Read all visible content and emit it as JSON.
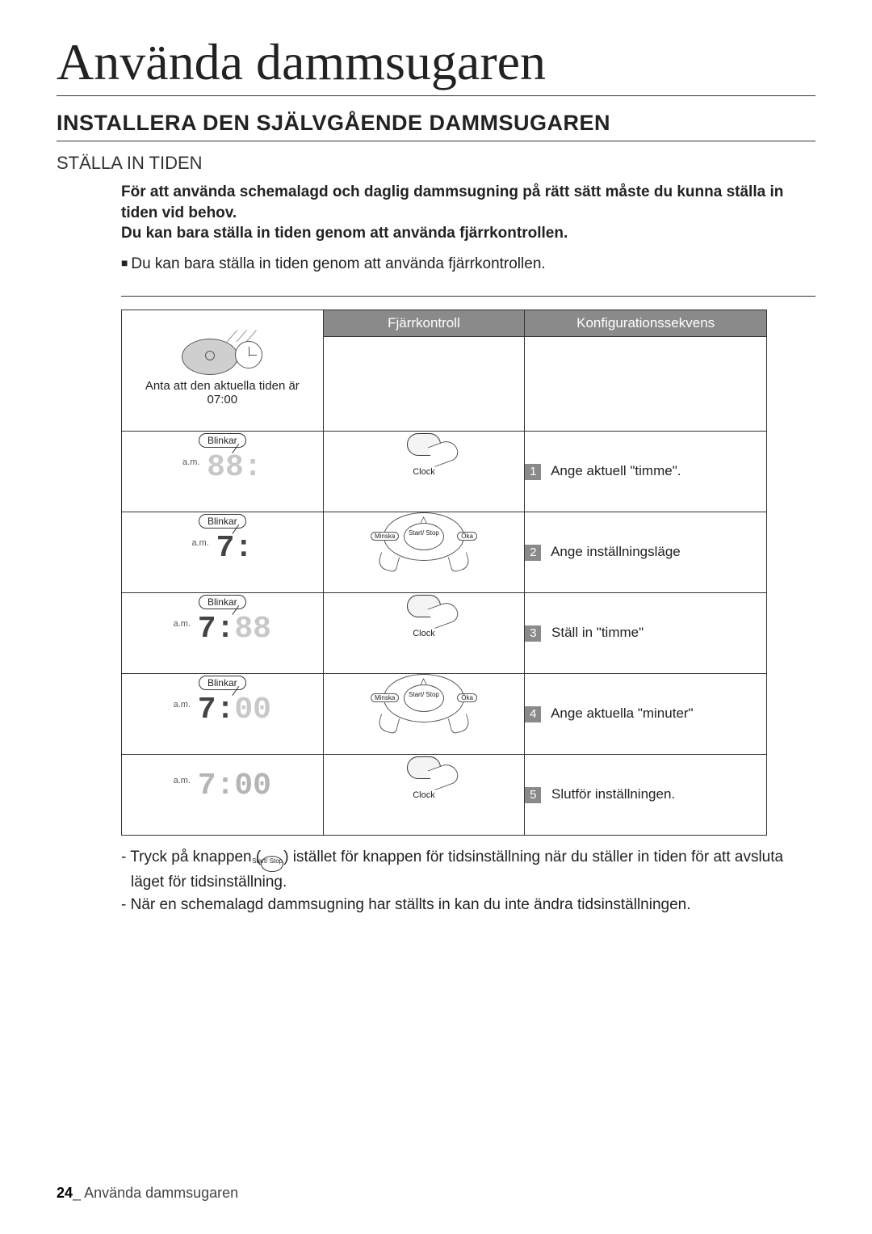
{
  "doc_title": "Använda dammsugaren",
  "section_title": "INSTALLERA DEN SJÄLVGÅENDE DAMMSUGAREN",
  "subsection_title": "STÄLLA IN TIDEN",
  "intro_line1": "För att använda schemalagd och daglig dammsugning på rätt sätt måste du kunna ställa in tiden vid behov.",
  "intro_line2": "Du kan bara ställa in tiden genom att använda fjärrkontrollen.",
  "bullet": "Du kan bara ställa in tiden genom att använda fjärrkontrollen.",
  "headers": {
    "remote": "Fjärrkontroll",
    "config": "Konfigurationssekvens"
  },
  "intro_cell": {
    "line1": "Anta att den aktuella tiden är",
    "line2": "07:00"
  },
  "labels": {
    "blinkar": "Blinkar",
    "am": "a.m.",
    "clock_btn": "Clock",
    "minska": "Minska",
    "oka": "Öka",
    "start_stop": "Start/\nStop"
  },
  "steps": [
    {
      "num": "1",
      "text": "Ange aktuell \"timme\".",
      "remote": "clock",
      "digits": "88:",
      "digit_style": "dim"
    },
    {
      "num": "2",
      "text": "Ange inställningsläge",
      "remote": "wheel",
      "digits": "7:",
      "digit_style": "dark"
    },
    {
      "num": "3",
      "text": "Ställ in \"timme\"",
      "remote": "clock",
      "digits": "7:88",
      "digit_style": "mix1"
    },
    {
      "num": "4",
      "text": "Ange aktuella \"minuter\"",
      "remote": "wheel",
      "digits": "7:00",
      "digit_style": "mix2"
    },
    {
      "num": "5",
      "text": "Slutför inställningen.",
      "remote": "clock",
      "digits": "7:00",
      "digit_style": "light",
      "no_blinkar": true
    }
  ],
  "notes": {
    "n1a": "- Tryck på knappen (",
    "n1_btn": "Start/\nStop",
    "n1b": ") istället för knappen för tidsinställning när du ställer in tiden för att avsluta läget för tidsinställning.",
    "n2": "- När en schemalagd dammsugning har ställts in kan du inte ändra tidsinställningen."
  },
  "footer": {
    "page": "24",
    "sep": "_ ",
    "text": "Använda dammsugaren"
  }
}
